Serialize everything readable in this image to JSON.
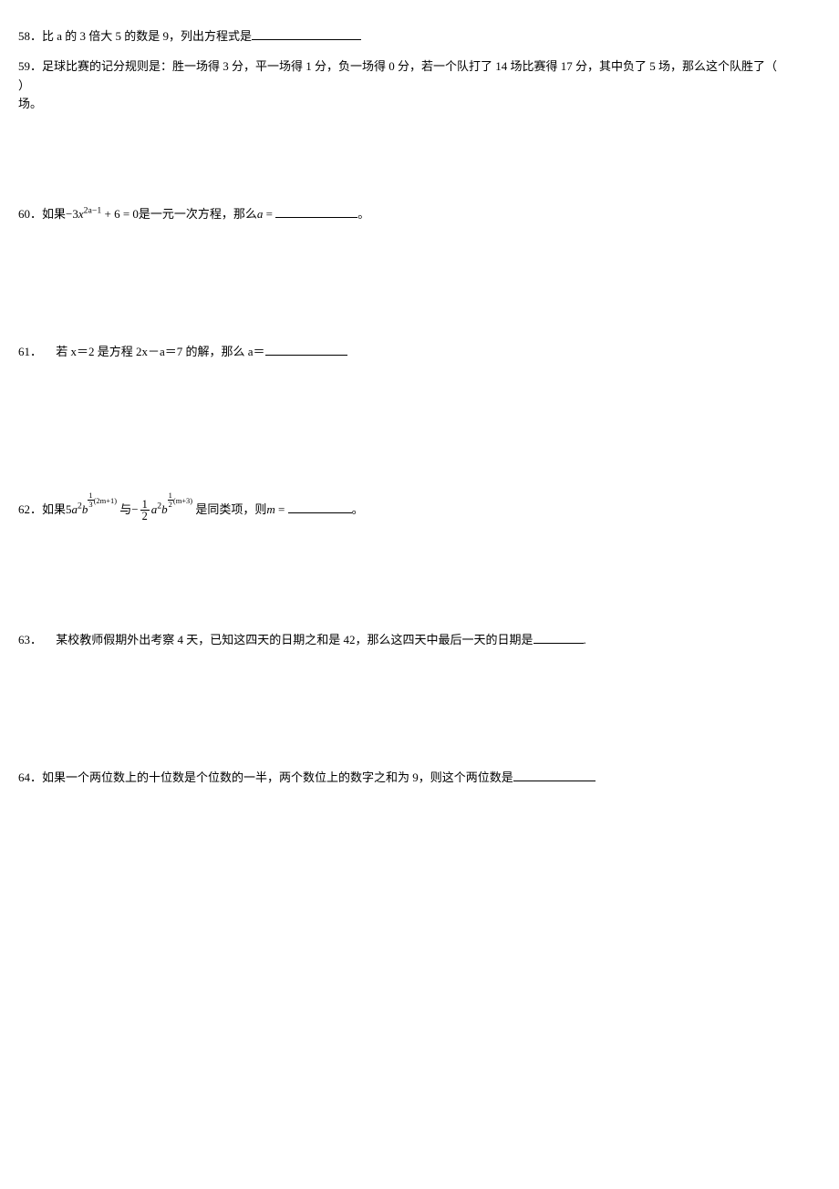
{
  "questions": {
    "q58": {
      "num": "58．",
      "text_before": "比 a 的 3 倍大 5 的数是 9，列出方程式是"
    },
    "q59": {
      "num": "59．",
      "text_before": "足球比赛的记分规则是：胜一场得 3 分，平一场得 1 分，负一场得 0 分，若一个队打了 14 场比赛得 17 分，其中负了 5 场，那么这个队胜了（",
      "text_after": "）",
      "line2": "场。"
    },
    "q60": {
      "num": "60．",
      "text_before": "如果",
      "math_part1": "−3",
      "math_var": "x",
      "math_exp": "2a−1",
      "math_part2": " + 6 = 0",
      "text_mid": "是一元一次方程，那么",
      "math_var2": "a",
      "math_eq": " = ",
      "text_after": "。"
    },
    "q61": {
      "num": "61．",
      "text_before": " 若 x＝2 是方程 2x－a＝7 的解，那么 a＝"
    },
    "q62": {
      "num": "62．",
      "text_before": "如果",
      "coef1": "5",
      "var_a": "a",
      "exp_a": "2",
      "var_b": "b",
      "exp_b_frac_num": "1",
      "exp_b_frac_den": "3",
      "exp_b_paren": "(2m+1)",
      "text_mid1": "与",
      "minus": "−",
      "frac_num": "1",
      "frac_den": "2",
      "var_a2": "a",
      "exp_a2": "2",
      "var_b2": "b",
      "exp_b2_frac_num": "1",
      "exp_b2_frac_den": "2",
      "exp_b2_paren": "(m+3)",
      "text_mid2": "是同类项，则",
      "var_m": "m",
      "eq": " = ",
      "text_after": "。"
    },
    "q63": {
      "num": "63．",
      "text_before": " 某校教师假期外出考察 4 天，已知这四天的日期之和是 42，那么这四天中最后一天的日期是",
      "text_after": "."
    },
    "q64": {
      "num": "64．",
      "text_before": "如果一个两位数上的十位数是个位数的一半，两个数位上的数字之和为 9，则这个两位数是"
    }
  }
}
